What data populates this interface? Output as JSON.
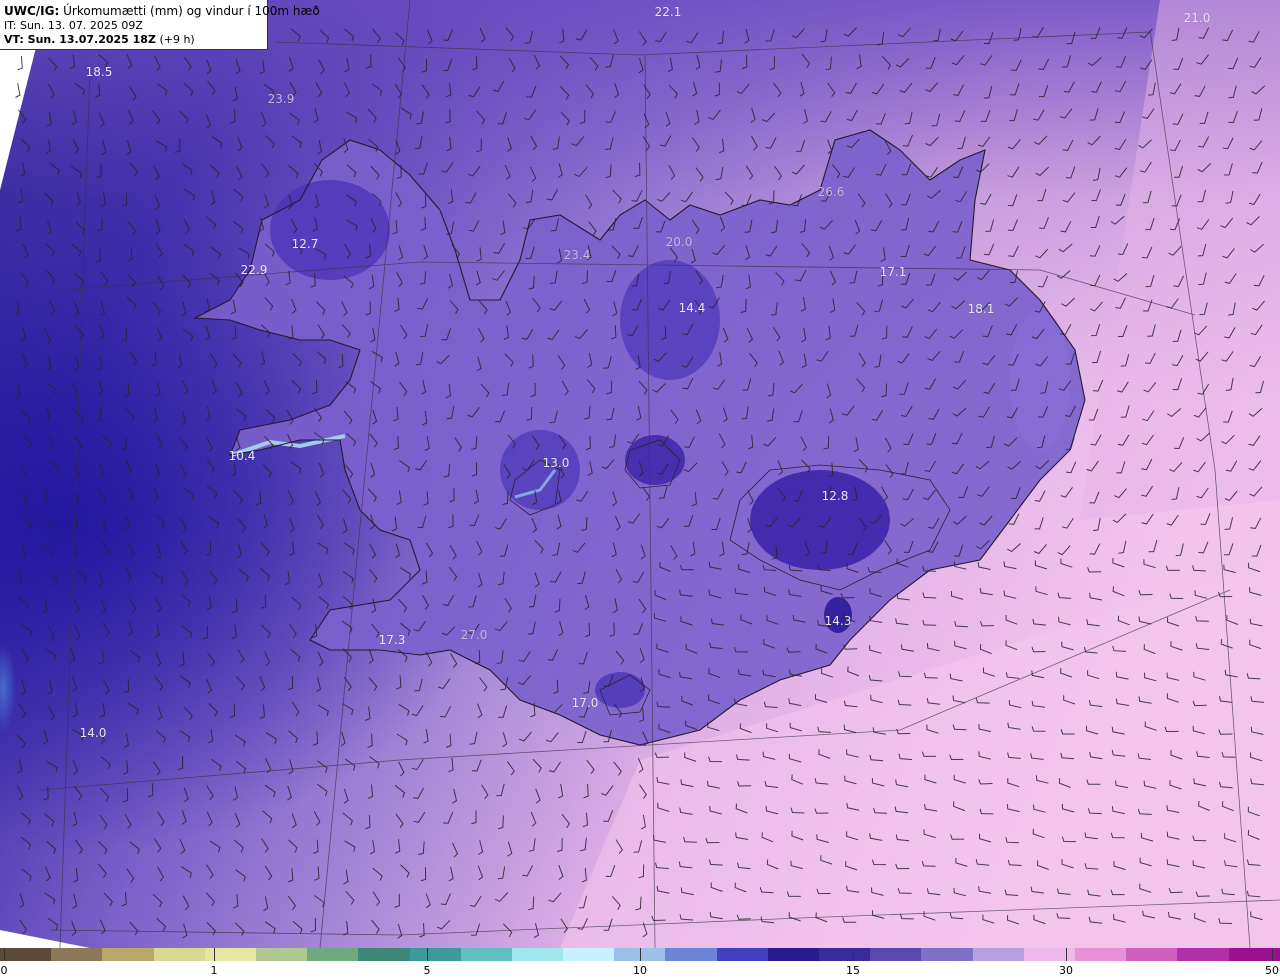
{
  "header": {
    "model_tag": "UWC/IG:",
    "title": "Úrkomumætti (mm) og vindur í 100m hæð",
    "it_line": "IT: Sun. 13. 07. 2025 09Z",
    "vt_prefix": "VT: Sun. 13.07.2025 18Z",
    "vt_suffix": "(+9 h)"
  },
  "temperatures": [
    {
      "value": "22.1"
    },
    {
      "value": "21.0"
    },
    {
      "value": "18.5"
    },
    {
      "value": "23.9"
    },
    {
      "value": "12.7"
    },
    {
      "value": "22.9"
    },
    {
      "value": "26.6"
    },
    {
      "value": "20.0"
    },
    {
      "value": "17.1"
    },
    {
      "value": "18.1"
    },
    {
      "value": "14.4"
    },
    {
      "value": "10.4"
    },
    {
      "value": "13.0"
    },
    {
      "value": "12.8"
    },
    {
      "value": "14.3"
    },
    {
      "value": "17.3"
    },
    {
      "value": "27.0"
    },
    {
      "value": "17.0"
    },
    {
      "value": "14.0"
    },
    {
      "value": "23.4"
    }
  ],
  "colorbar": {
    "labels": [
      "0",
      "1",
      "5",
      "10",
      "15",
      "30",
      "50"
    ],
    "colors": [
      "#5c4a3a",
      "#8a7a5a",
      "#b8a86a",
      "#d8d890",
      "#e6e6a0",
      "#b0c890",
      "#70a880",
      "#3c8878",
      "#3c9a98",
      "#60c0c0",
      "#a0e8f0",
      "#c8f0ff",
      "#9cc0e8",
      "#6c84d8",
      "#4040c0",
      "#2a1a90",
      "#3a2a9a",
      "#5a48b0",
      "#8070c8",
      "#b8a0e0",
      "#f0b8e8",
      "#e890d8",
      "#d060c0",
      "#b030a8",
      "#9a1090"
    ]
  },
  "colors": {
    "sea_dark": "#2a1f9a",
    "land_purple": "#6a50c0",
    "pink": "#f0c0e8",
    "coast": "#2a2230"
  }
}
